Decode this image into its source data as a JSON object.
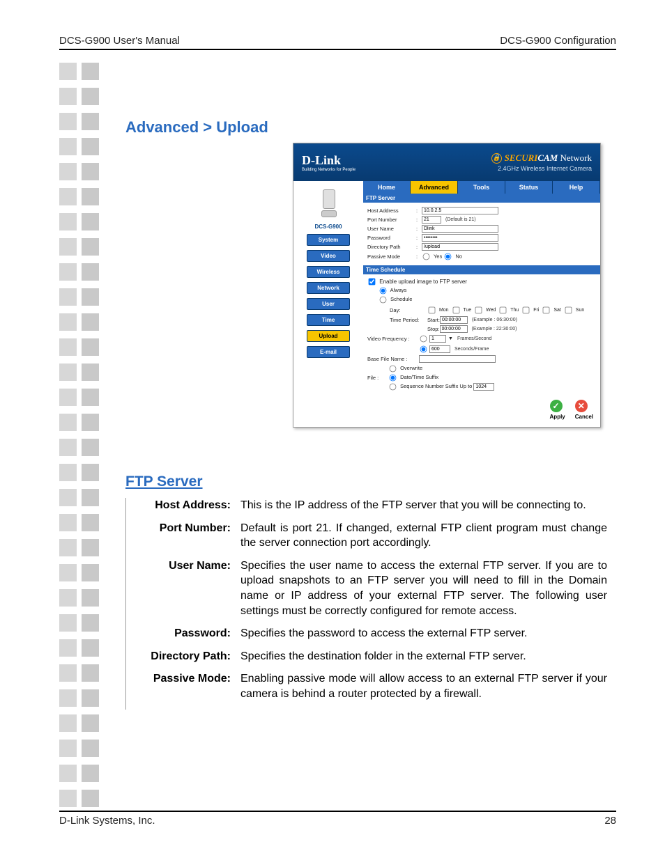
{
  "header": {
    "left": "DCS-G900 User's Manual",
    "right": "DCS-G900 Configuration"
  },
  "title": "Advanced > Upload",
  "shot": {
    "logo": "D-Link",
    "logo_tag": "Building Networks for People",
    "securicam_prefix": "SECURI",
    "securicam_cam": "CAM",
    "securicam_suffix": " Network",
    "subtitle": "2.4GHz Wireless Internet Camera",
    "model": "DCS-G900",
    "nav": [
      "System",
      "Video",
      "Wireless",
      "Network",
      "User",
      "Time",
      "Upload",
      "E-mail"
    ],
    "nav_active": "Upload",
    "tabs": [
      "Home",
      "Advanced",
      "Tools",
      "Status",
      "Help"
    ],
    "tab_active": "Advanced",
    "ftp_section": "FTP Server",
    "host_address_label": "Host Address",
    "host_address_value": "10.0.2.5",
    "port_number_label": "Port Number",
    "port_number_value": "21",
    "port_hint": "(Default is 21)",
    "user_name_label": "User Name",
    "user_name_value": "Dlink",
    "password_label": "Password",
    "password_value": "••••••••",
    "directory_label": "Directory Path",
    "directory_value": "/upload",
    "passive_label": "Passive Mode",
    "yes": "Yes",
    "no": "No",
    "ts_section": "Time Schedule",
    "enable_upload": "Enable upload image to FTP server",
    "always": "Always",
    "schedule": "Schedule",
    "day_label": "Day:",
    "days": [
      "Mon",
      "Tue",
      "Wed",
      "Thu",
      "Fri",
      "Sat",
      "Sun"
    ],
    "time_period_label": "Time Period:",
    "start_label": "Start:",
    "start_value": "00:00:00",
    "start_hint": "(Example : 06:30:00)",
    "stop_label": "Stop:",
    "stop_value": "00:00:00",
    "stop_hint": "(Example : 22:30:00)",
    "vf_label": "Video Frequency :",
    "vf_fps_value": "1",
    "vf_fps_unit": "Frames/Second",
    "vf_spf_value": "600",
    "vf_spf_unit": "Seconds/Frame",
    "base_label": "Base File Name :",
    "file_label": "File :",
    "overwrite": "Overwrite",
    "datetime": "Date/Time Suffix",
    "seq": "Sequence Number Suffix Up to",
    "seq_value": "1024",
    "apply": "Apply",
    "cancel": "Cancel"
  },
  "ftp_title": "FTP Server",
  "defs": [
    {
      "t": "Host Address:",
      "d": "This is the IP address of the FTP server that you will be connecting to."
    },
    {
      "t": "Port Number:",
      "d": "Default is port 21. If changed, external FTP client program must change the server connection port accordingly."
    },
    {
      "t": "User Name:",
      "d": "Specifies the user name to access the external FTP server. If you are to upload snapshots to an FTP server you will need to fill in the Domain name or IP address of your external FTP server. The following user settings must be correctly configured for remote access."
    },
    {
      "t": "Password:",
      "d": "Specifies the password to access the external FTP server."
    },
    {
      "t": "Directory Path:",
      "d": "Specifies the destination folder in the external FTP server."
    },
    {
      "t": "Passive Mode:",
      "d": "Enabling passive mode will allow access to an external FTP server if your camera is behind a router protected by a firewall."
    }
  ],
  "footer": {
    "left": "D-Link Systems, Inc.",
    "right": "28"
  }
}
